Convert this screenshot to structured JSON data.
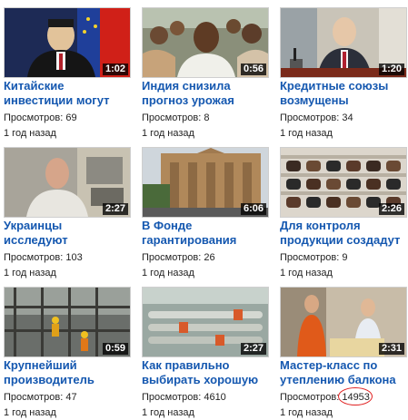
{
  "videos": [
    {
      "title1": "Китайские",
      "title2": "инвестиции могут",
      "duration": "1:02",
      "views_label": "Просмотров:",
      "views": "69",
      "age": "1 год назад"
    },
    {
      "title1": "Индия снизила",
      "title2": "прогноз урожая",
      "duration": "0:56",
      "views_label": "Просмотров:",
      "views": "8",
      "age": "1 год назад"
    },
    {
      "title1": "Кредитные союзы",
      "title2": "возмущены",
      "duration": "1:20",
      "views_label": "Просмотров:",
      "views": "34",
      "age": "1 год назад"
    },
    {
      "title1": "Украинцы",
      "title2": "исследуют",
      "duration": "2:27",
      "views_label": "Просмотров:",
      "views": "103",
      "age": "1 год назад"
    },
    {
      "title1": "В Фонде",
      "title2": "гарантирования",
      "duration": "6:06",
      "views_label": "Просмотров:",
      "views": "26",
      "age": "1 год назад"
    },
    {
      "title1": "Для контроля",
      "title2": "продукции создадут",
      "duration": "2:26",
      "views_label": "Просмотров:",
      "views": "9",
      "age": "1 год назад"
    },
    {
      "title1": "Крупнейший",
      "title2": "производитель",
      "duration": "0:59",
      "views_label": "Просмотров:",
      "views": "47",
      "age": "1 год назад"
    },
    {
      "title1": "Как правильно",
      "title2": "выбирать хорошую",
      "duration": "2:27",
      "views_label": "Просмотров:",
      "views": "4610",
      "age": "1 год назад"
    },
    {
      "title1": "Мастер-класс по",
      "title2": "утеплению балкона",
      "duration": "2:31",
      "views_label": "Просмотров:",
      "views": "14953",
      "age": "1 год назад"
    }
  ],
  "thumbnails": [
    "official-with-eu-flag",
    "man-in-crowd",
    "speaker-at-microphone",
    "man-in-workshop",
    "ornate-building",
    "shoe-display-shelves",
    "construction-scaffolding",
    "pipes-on-rack",
    "two-men-balcony"
  ],
  "colors": {
    "link": "#1558b0",
    "highlight_circle": "#e02020"
  }
}
